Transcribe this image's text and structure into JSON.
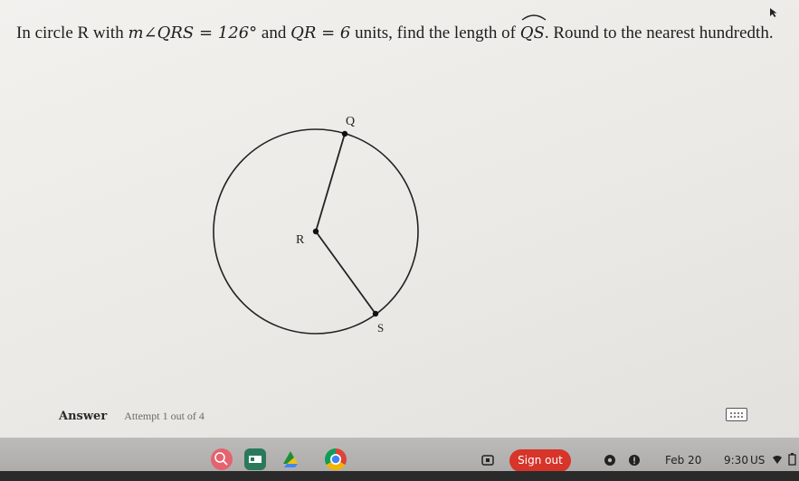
{
  "question": {
    "lead": "In circle R with ",
    "angle_expr": "m∠QRS = 126°",
    "mid": " and ",
    "radius_expr": "QR = 6",
    "after": " units, find the length of ",
    "arc_name": "QS",
    "tail": ". Round to the nearest hundredth."
  },
  "diagram": {
    "label_q": "Q",
    "label_r": "R",
    "label_s": "S"
  },
  "answer": {
    "label": "Answer",
    "attempt": "Attempt 1 out of 4"
  },
  "shelf": {
    "sign_out": "Sign out",
    "date": "Feb 20",
    "time": "9:30",
    "region": "US",
    "colors": {
      "sign_out_bg": "#d7342a"
    }
  }
}
